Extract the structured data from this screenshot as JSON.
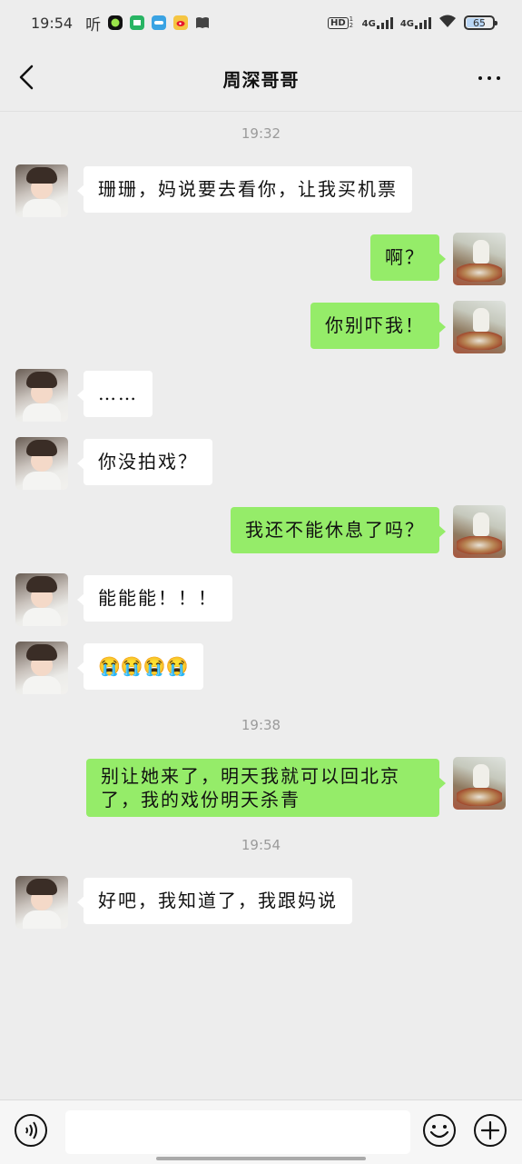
{
  "status_bar": {
    "time": "19:54",
    "listen_label": "听",
    "hd_label": "HD",
    "hd_sub": "1 2",
    "net1": "4G",
    "net2": "4G",
    "battery": "65",
    "icons": [
      "music-app-icon",
      "game-app-icon",
      "video-app-icon",
      "weibo-icon",
      "book-icon"
    ]
  },
  "nav": {
    "title": "周深哥哥"
  },
  "chat": {
    "times": [
      "19:32",
      "19:38",
      "19:54"
    ],
    "messages": [
      {
        "side": "left",
        "text": "珊珊，妈说要去看你，让我买机票"
      },
      {
        "side": "right",
        "text": "啊？"
      },
      {
        "side": "right",
        "text": "你别吓我！"
      },
      {
        "side": "left",
        "text": "……"
      },
      {
        "side": "left",
        "text": "你没拍戏？"
      },
      {
        "side": "right",
        "text": "我还不能休息了吗？"
      },
      {
        "side": "left",
        "text": "能能能！！！"
      },
      {
        "side": "left",
        "text": "😭😭😭😭"
      },
      {
        "side": "right",
        "text": "别让她来了，明天我就可以回北京了，我的戏份明天杀青"
      },
      {
        "side": "left",
        "text": "好吧，我知道了，我跟妈说"
      }
    ]
  },
  "input_bar": {
    "placeholder": ""
  },
  "colors": {
    "background": "#ededed",
    "bubble_self": "#95ec69",
    "bubble_other": "#ffffff",
    "timestamp": "#9b9b9b"
  }
}
